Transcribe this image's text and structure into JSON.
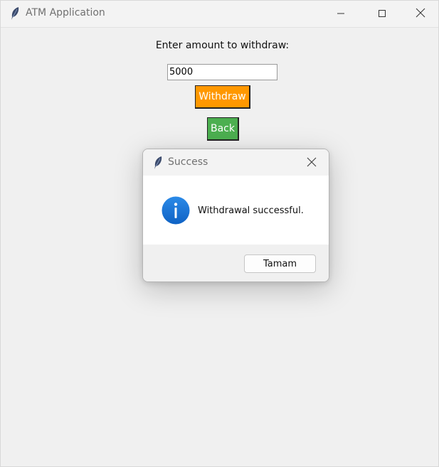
{
  "window": {
    "title": "ATM Application",
    "app_icon": "feather-icon",
    "controls": [
      "minimize-icon",
      "maximize-icon",
      "close-icon"
    ]
  },
  "form": {
    "prompt": "Enter amount to withdraw:",
    "amount_value": "5000",
    "withdraw_label": "Withdraw",
    "back_label": "Back"
  },
  "dialog": {
    "title": "Success",
    "icon": "info-icon",
    "message": "Withdrawal successful.",
    "ok_label": "Tamam"
  },
  "colors": {
    "withdraw_button": "#ff9800",
    "back_button": "#4caf50",
    "info_icon": "#1a73d6"
  }
}
